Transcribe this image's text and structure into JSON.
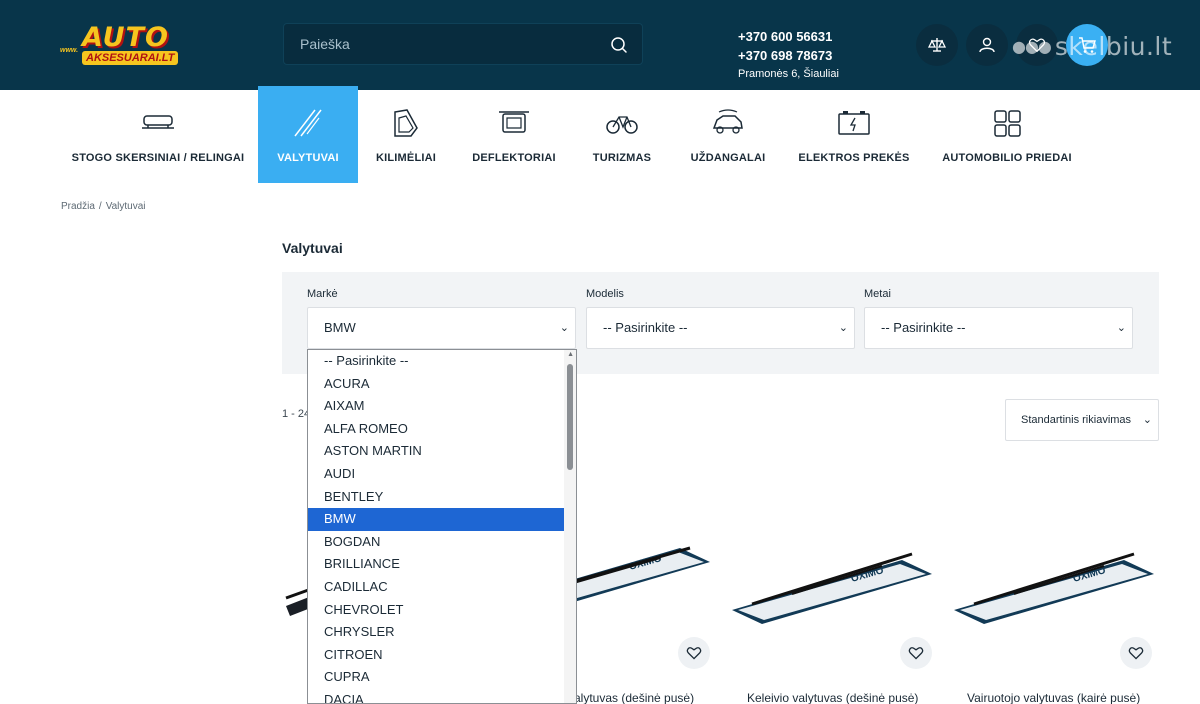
{
  "header": {
    "logo_top": "AUTO",
    "logo_www": "www.",
    "logo_bottom": "AKSESUARAI.LT",
    "search_placeholder": "Paieška",
    "phone1": "+370 600 56631",
    "phone2": "+370 698 78673",
    "address": "Pramonės 6, Šiauliai",
    "watermark": "skelbiu.lt"
  },
  "categories": [
    {
      "label": "STOGO SKERSINIAI / RELINGAI",
      "icon": "roof-rack-icon"
    },
    {
      "label": "VALYTUVAI",
      "icon": "wiper-icon",
      "active": true
    },
    {
      "label": "KILIMĖLIAI",
      "icon": "floor-mat-icon"
    },
    {
      "label": "DEFLEKTORIAI",
      "icon": "deflector-icon"
    },
    {
      "label": "TURIZMAS",
      "icon": "bicycle-icon"
    },
    {
      "label": "UŽDANGALAI",
      "icon": "car-cover-icon"
    },
    {
      "label": "ELEKTROS PREKĖS",
      "icon": "battery-icon"
    },
    {
      "label": "AUTOMOBILIO PRIEDAI",
      "icon": "grid-icon"
    }
  ],
  "breadcrumb": {
    "home": "Pradžia",
    "sep": "/",
    "current": "Valytuvai"
  },
  "page_title": "Valytuvai",
  "filters": {
    "brand_label": "Markė",
    "brand_value": "BMW",
    "model_label": "Modelis",
    "model_value": "-- Pasirinkite --",
    "year_label": "Metai",
    "year_value": "-- Pasirinkite --"
  },
  "dropdown_options": [
    "-- Pasirinkite --",
    "ACURA",
    "AIXAM",
    "ALFA ROMEO",
    "ASTON MARTIN",
    "AUDI",
    "BENTLEY",
    "BMW",
    "BOGDAN",
    "BRILLIANCE",
    "CADILLAC",
    "CHEVROLET",
    "CHRYSLER",
    "CITROEN",
    "CUPRA",
    "DACIA"
  ],
  "dropdown_selected": "BMW",
  "results_count": "1 - 24",
  "sort": {
    "value": "Standartinis rikiavimas"
  },
  "products": [
    {
      "name": ""
    },
    {
      "name": "valytuvas (dešinė pusė)"
    },
    {
      "name": "Keleivio valytuvas (dešinė pusė)"
    },
    {
      "name": "Vairuotojo valytuvas (kairė pusė)"
    }
  ],
  "product_brand": "OXIMO",
  "colors": {
    "header_bg": "#08354a",
    "accent": "#3aaef2",
    "selected_option": "#1e66d3"
  }
}
